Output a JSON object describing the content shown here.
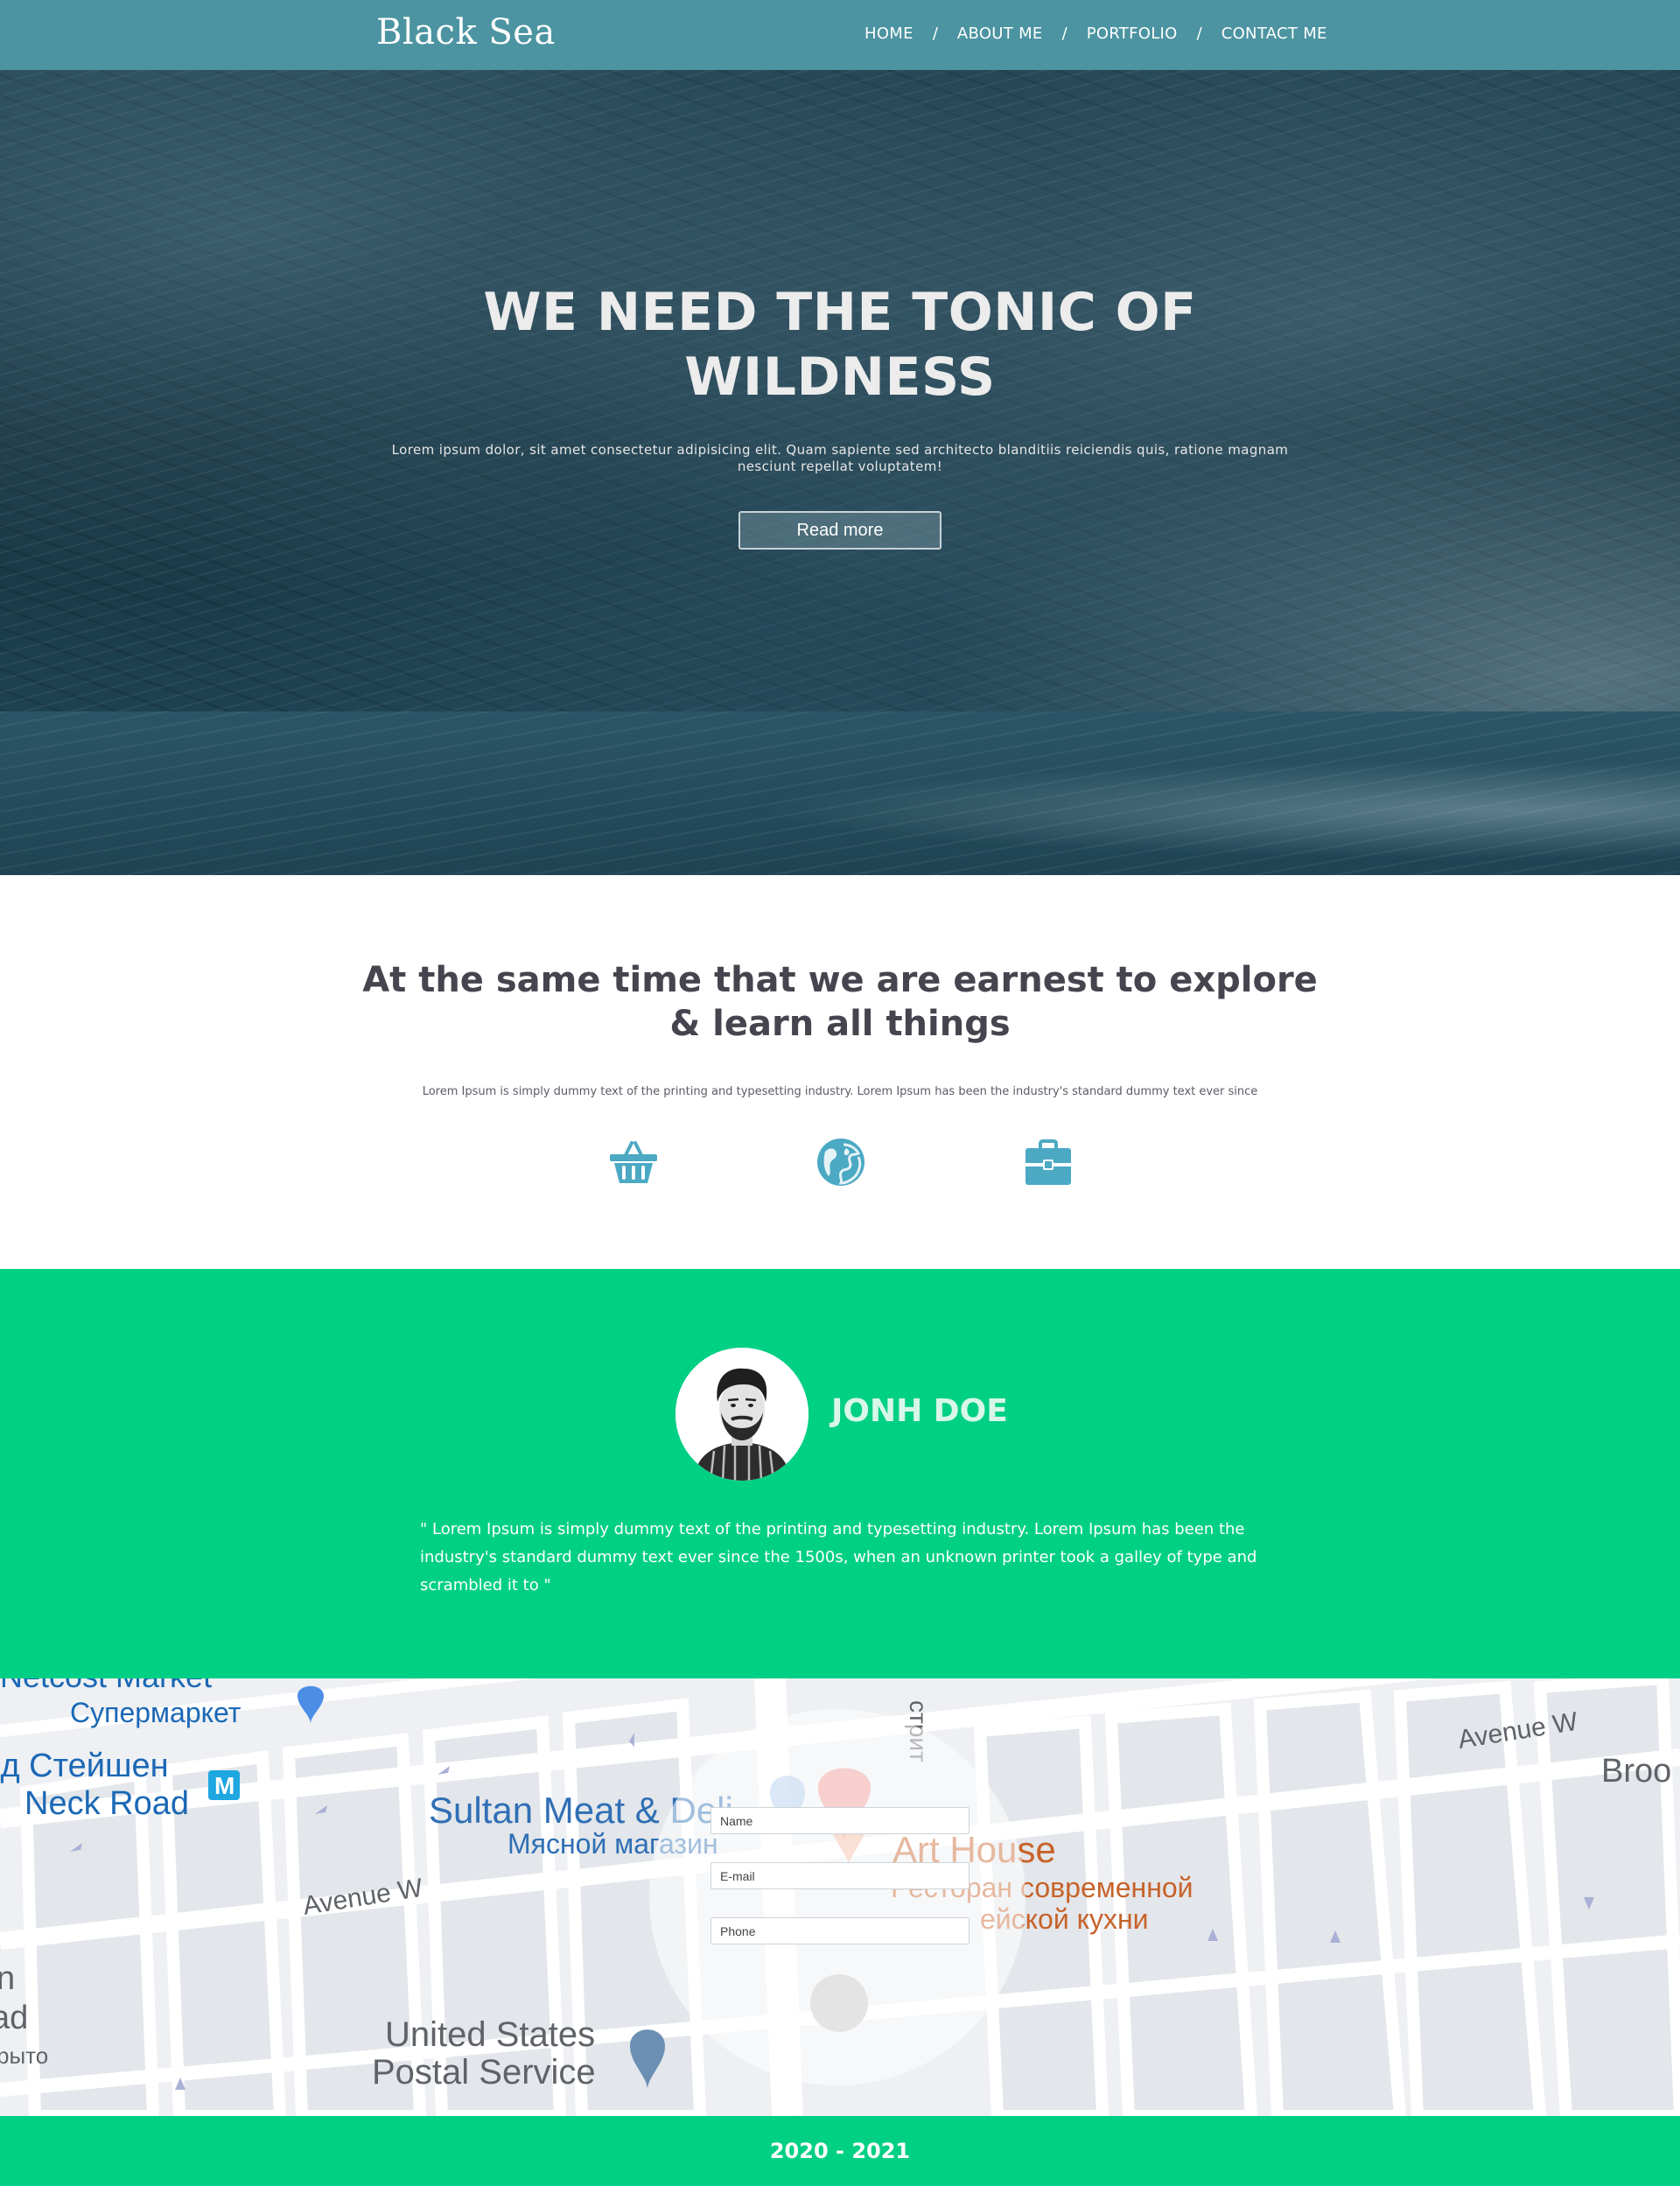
{
  "header": {
    "logo": "Black Sea",
    "nav": [
      "HOME",
      "ABOUT ME",
      "PORTFOLIO",
      "CONTACT ME"
    ],
    "separator": "/"
  },
  "hero": {
    "title_line1": "WE NEED THE TONIC OF",
    "title_line2": "WILDNESS",
    "text": "Lorem ipsum dolor, sit amet consectetur adipisicing elit. Quam sapiente sed architecto blanditiis reiciendis quis, ratione magnam nesciunt repellat voluptatem!",
    "button": "Read more"
  },
  "about": {
    "title_line1": "At the same time that we are earnest to explore",
    "title_line2": "& learn all things",
    "text": "Lorem Ipsum is simply dummy text of the printing and typesetting industry. Lorem Ipsum has been the industry's standard dummy text ever since",
    "icons": [
      "basket-icon",
      "globe-icon",
      "briefcase-icon"
    ],
    "icon_color": "#4ba9c4"
  },
  "testimonial": {
    "name": "JONH DOE",
    "quote": "\" Lorem Ipsum is simply dummy text of the printing and typesetting industry. Lorem Ipsum has been the industry's standard dummy text ever since the 1500s, when an unknown printer took a galley of type and scrambled it to \"",
    "background": "#00d084"
  },
  "map": {
    "labels": {
      "market_top": "Netcost Market",
      "market_ru": "Супермаркет",
      "station_ru": "ід Стейшен",
      "neck_road": "Neck Road",
      "metro": "M",
      "sultan": "Sultan Meat & Deli",
      "sultan_ru": "Мясной магазин",
      "art_house": "Art House",
      "art_house_ru1": "Ресторан современной",
      "art_house_ru2": "ейской кухни",
      "avenue_w_left": "Avenue W",
      "avenue_w_right": "Avenue W",
      "street_vertical": "стрит",
      "broo": "Broo",
      "usps1": "United States",
      "usps2": "Postal Service",
      "left_n": "n",
      "left_ad": "ad",
      "left_ru": "рыто"
    }
  },
  "contact_form": {
    "name_placeholder": "Name",
    "email_placeholder": "E-mail",
    "phone_placeholder": "Phone"
  },
  "footer": {
    "text": "2020 - 2021"
  }
}
